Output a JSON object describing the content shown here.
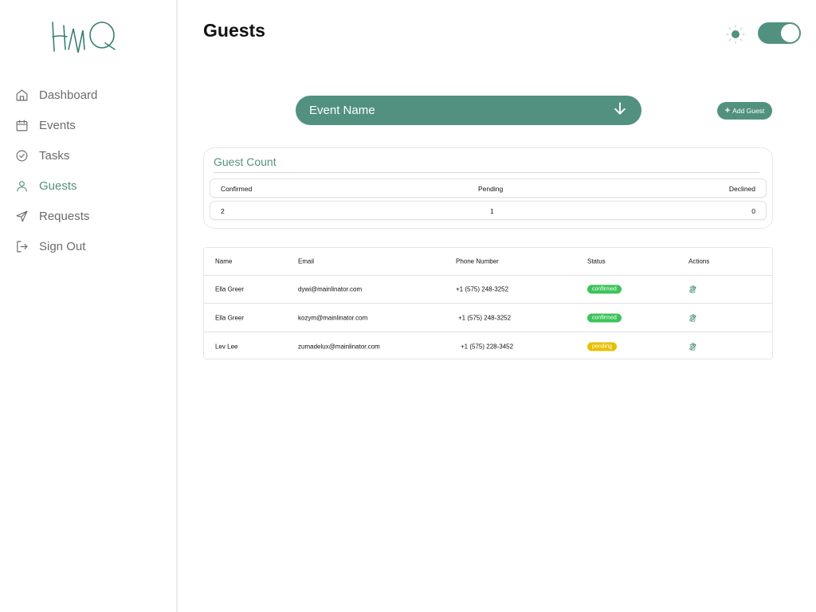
{
  "sidebar": {
    "items": [
      {
        "label": "Dashboard",
        "icon": "home-icon"
      },
      {
        "label": "Events",
        "icon": "calendar-icon"
      },
      {
        "label": "Tasks",
        "icon": "check-circle-icon"
      },
      {
        "label": "Guests",
        "icon": "user-icon",
        "active": true
      },
      {
        "label": "Requests",
        "icon": "send-icon"
      },
      {
        "label": "Sign Out",
        "icon": "sign-out-icon"
      }
    ]
  },
  "header": {
    "title": "Guests"
  },
  "event_select": {
    "value": "Event Name"
  },
  "add_guest": {
    "label": "Add Guest"
  },
  "guest_count": {
    "title": "Guest Count",
    "headers": [
      "Confirmed",
      "Pending",
      "Declined"
    ],
    "values": [
      "2",
      "1",
      "0"
    ]
  },
  "table": {
    "columns": [
      "Name",
      "Email",
      "Phone Number",
      "Status",
      "Actions"
    ],
    "rows": [
      {
        "name": "Ella Greer",
        "email": "dywi@mainlinator.com",
        "phone": "+1 (575) 248-3252",
        "status": "confirmed"
      },
      {
        "name": "Ella Greer",
        "email": "kozym@mainlinator.com",
        "phone": "+1 (575) 248-3252",
        "status": "confirmed"
      },
      {
        "name": "Lev Lee",
        "email": "zumadelux@mainlinator.com",
        "phone": "+1 (575) 228-3452",
        "status": "pending"
      }
    ]
  },
  "colors": {
    "accent": "#52917f",
    "confirmed": "#3cc35a",
    "pending": "#e8c000"
  }
}
